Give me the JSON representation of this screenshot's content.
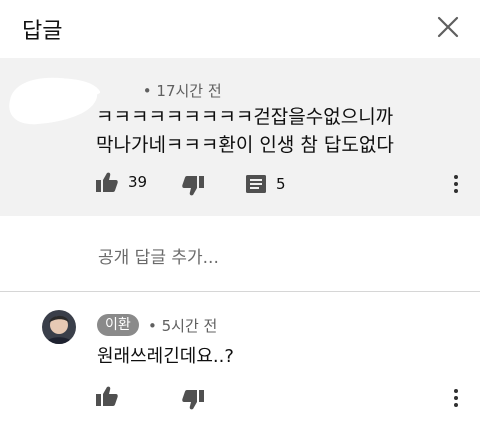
{
  "header": {
    "title": "답글"
  },
  "parent_comment": {
    "timestamp": "17시간 전",
    "text_lines": [
      "ㅋㅋㅋㅋㅋㅋㅋㅋㅋ걷잡을수없으니까",
      "막나가네ㅋㅋㅋ환이 인생 참 답도없다"
    ],
    "like_count": "39",
    "reply_count": "5"
  },
  "add_reply": {
    "placeholder": "공개 답글 추가..."
  },
  "reply": {
    "author": "이환",
    "timestamp": "5시간 전",
    "text": "원래쓰레긴데요..?"
  },
  "colors": {
    "parent_bg": "#f2f2f2",
    "chip_bg": "#8a8a8a",
    "meta_text": "#606060"
  }
}
